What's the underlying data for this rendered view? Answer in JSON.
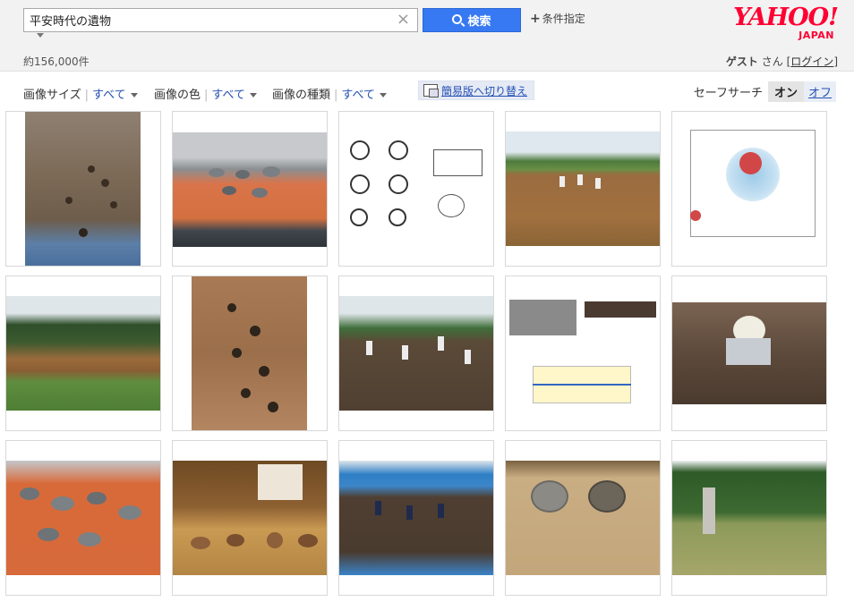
{
  "search": {
    "query": "平安時代の遺物",
    "clear_glyph": "×",
    "button_label": "検索",
    "conditions_label": "条件指定",
    "conditions_glyph": "+"
  },
  "logo": {
    "main": "YAHOO!",
    "sub": "JAPAN"
  },
  "results": {
    "count_text": "約156,000件"
  },
  "user": {
    "name": "ゲスト",
    "suffix": "さん",
    "bracket_open": "[",
    "login": "ログイン",
    "bracket_close": "]"
  },
  "filters": [
    {
      "label": "画像サイズ",
      "value": "すべて"
    },
    {
      "label": "画像の色",
      "value": "すべて"
    },
    {
      "label": "画像の種類",
      "value": "すべて"
    }
  ],
  "simple_toggle": {
    "label": "簡易版へ切り替え"
  },
  "safe_search": {
    "label": "セーフサーチ",
    "on": "オン",
    "off": "オフ",
    "state": "on"
  },
  "colors": {
    "accent": "#3679f2",
    "brand": "#ff0033",
    "link": "#2550b4"
  },
  "grid_images": [
    "image-result-excavation-site-tarp",
    "image-result-artifact-display-table",
    "image-result-coin-drawings",
    "image-result-field-excavation-workers",
    "image-result-site-distribution-map",
    "image-result-excavation-pit-trees",
    "image-result-excavation-postholes",
    "image-result-workers-excavation-field",
    "image-result-artifact-report-figure",
    "image-result-worker-in-pit",
    "image-result-pottery-shards-tarp",
    "image-result-museum-pottery-display",
    "image-result-excavation-workers-blue-tarp",
    "image-result-museum-bowls",
    "image-result-stone-monument-park"
  ]
}
